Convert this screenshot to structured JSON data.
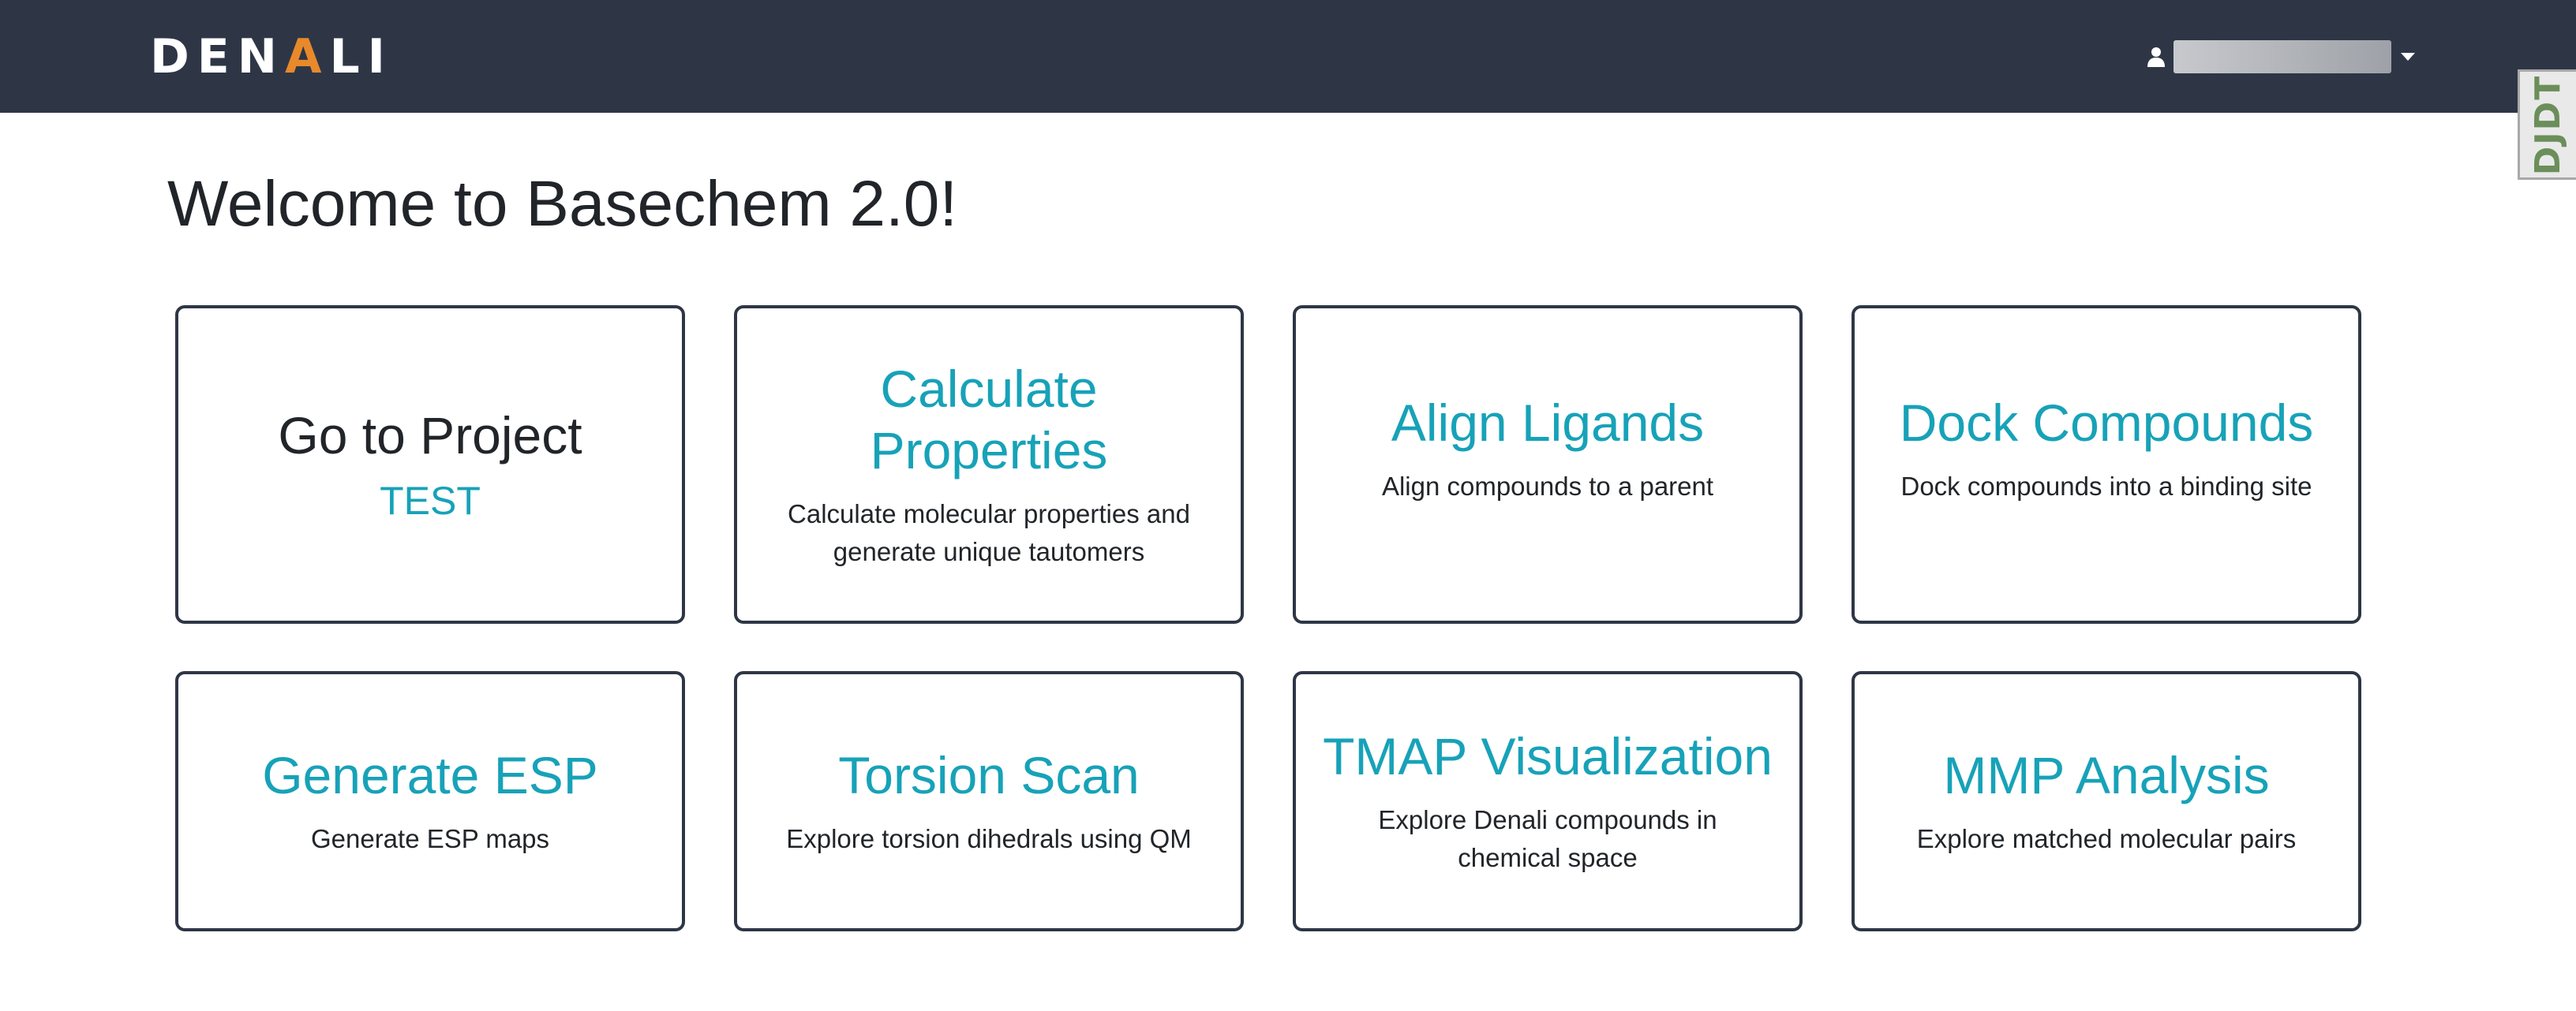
{
  "navbar": {
    "logo_text_part1": "DEN",
    "logo_text_accent": "A",
    "logo_text_part2": "LI",
    "user_icon": "user-icon",
    "caret_icon": "caret-down-icon",
    "accent_color": "#e8892b",
    "background_color": "#2e3646"
  },
  "side_tab": {
    "label": "DJDT"
  },
  "page": {
    "title": "Welcome to Basechem 2.0!"
  },
  "cards": [
    {
      "title": "Go to Project",
      "subtitle": "TEST",
      "description": ""
    },
    {
      "title": "Calculate Properties",
      "description": "Calculate molecular properties and generate unique tautomers"
    },
    {
      "title": "Align Ligands",
      "description": "Align compounds to a parent"
    },
    {
      "title": "Dock Compounds",
      "description": "Dock compounds into a binding site"
    },
    {
      "title": "Generate ESP",
      "description": "Generate ESP maps"
    },
    {
      "title": "Torsion Scan",
      "description": "Explore torsion dihedrals using QM"
    },
    {
      "title": "TMAP Visualization",
      "description": "Explore Denali compounds in chemical space"
    },
    {
      "title": "MMP Analysis",
      "description": "Explore matched molecular pairs"
    }
  ],
  "colors": {
    "link": "#17a2b8",
    "card_border": "#2e3646"
  }
}
